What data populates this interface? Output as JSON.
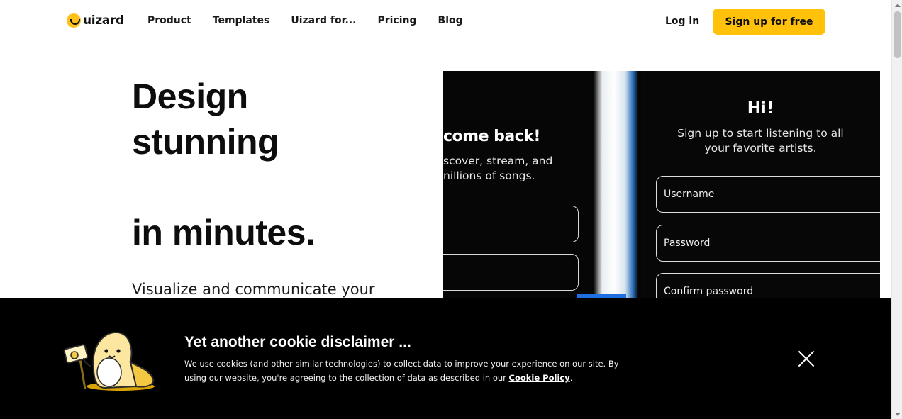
{
  "header": {
    "logo_text": "uizard",
    "nav": [
      "Product",
      "Templates",
      "Uizard for...",
      "Pricing",
      "Blog"
    ],
    "login_label": "Log in",
    "signup_label": "Sign up for free"
  },
  "hero": {
    "title_lines": [
      "Design",
      "stunning",
      "",
      "in minutes."
    ],
    "subtitle": "Visualize and communicate your"
  },
  "showcase": {
    "left_screen": {
      "title": "come back!",
      "subtitle_lines": [
        "scover, stream, and",
        "nillions of songs."
      ]
    },
    "right_screen": {
      "title": "Hi!",
      "subtitle_lines": [
        "Sign up to start listening to all",
        "your favorite artists."
      ],
      "fields": [
        "Username",
        "Password",
        "Confirm password"
      ]
    }
  },
  "cookie": {
    "title": "Yet another cookie disclaimer ...",
    "text": "We use cookies (and other similar technologies) to collect data to improve your experience on our site. By using our website, you're agreeing to the collection of data as described in our ",
    "link_label": "Cookie Policy",
    "text_end": "."
  },
  "colors": {
    "accent": "#ffc10a",
    "banner_bg": "#000000",
    "showcase_bg": "#050505"
  }
}
